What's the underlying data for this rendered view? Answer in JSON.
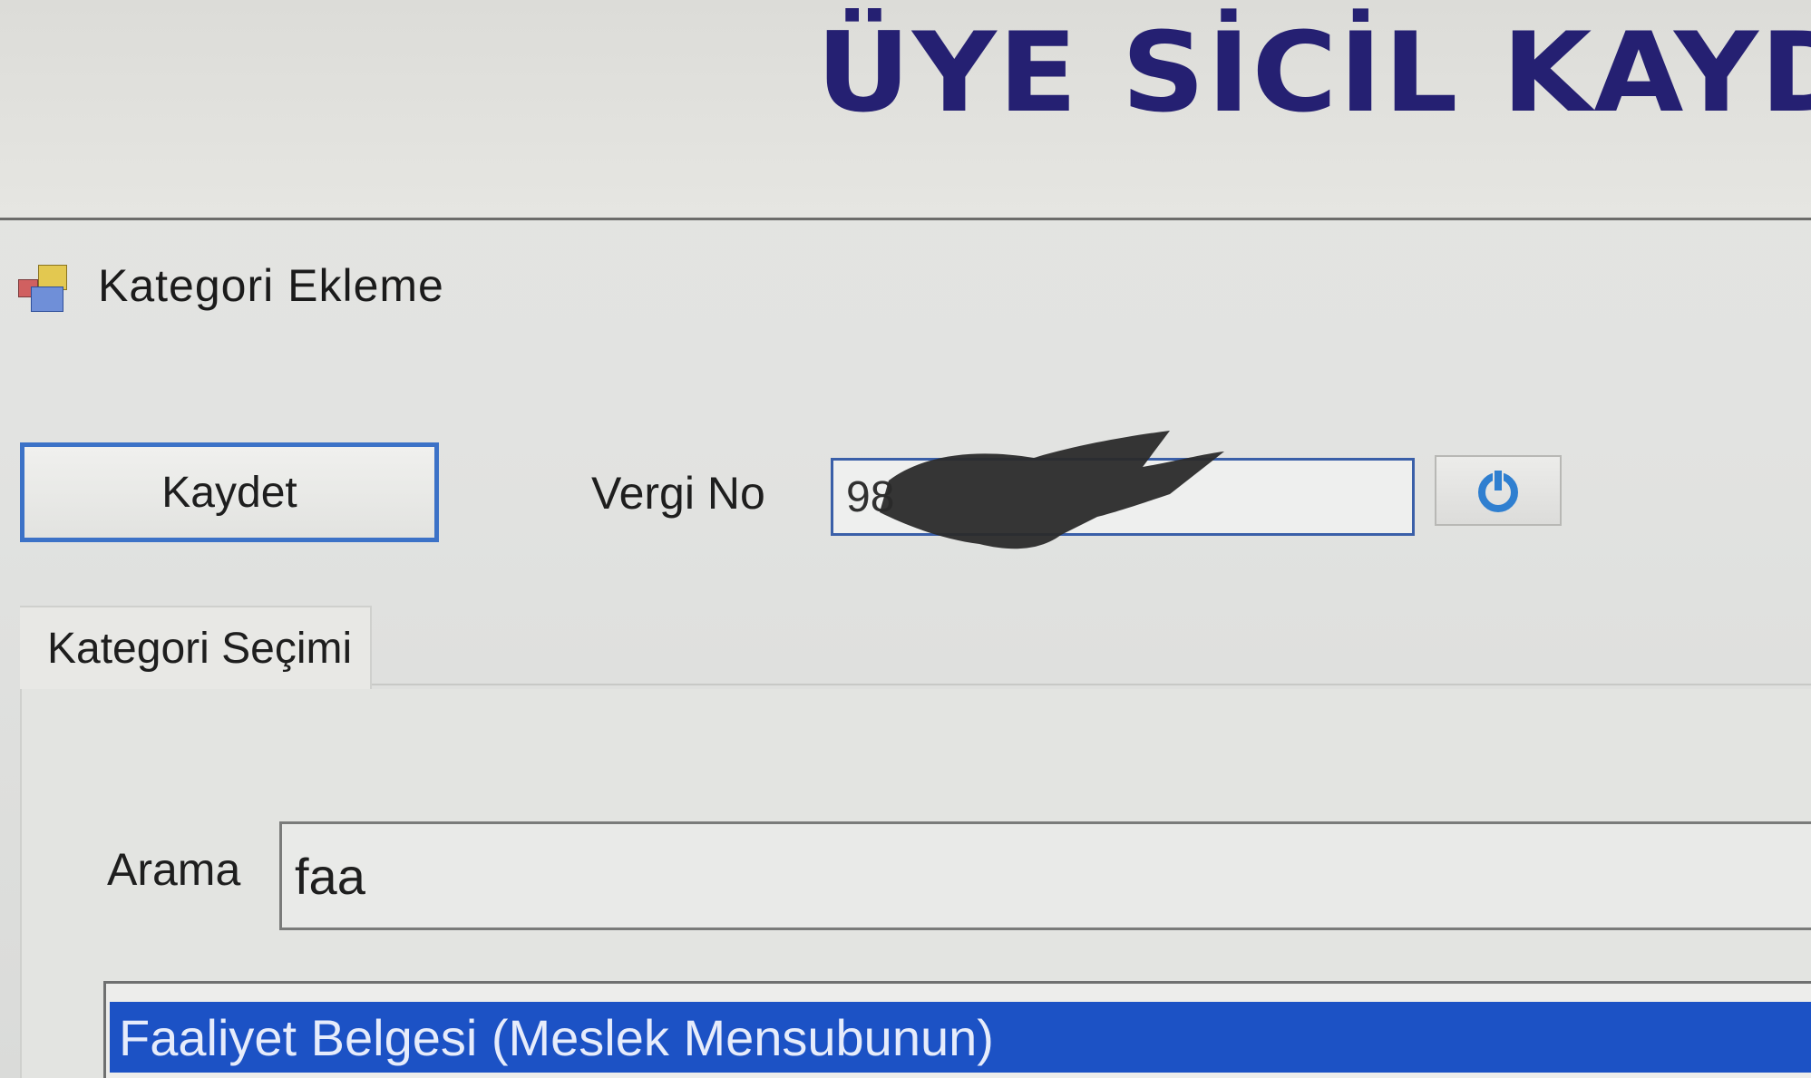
{
  "header": {
    "main_title": "ÜYE SİCİL KAYDI"
  },
  "window": {
    "title": "Kategori Ekleme",
    "icon": "app-window-icon"
  },
  "toolbar": {
    "save_label": "Kaydet",
    "tax_no_label": "Vergi No",
    "tax_no_value": "98",
    "tax_no_value_redacted": true,
    "refresh_icon": "refresh-icon",
    "accent_color": "#3c72c7"
  },
  "tabs": [
    {
      "label": "Kategori Seçimi",
      "active": true
    }
  ],
  "search": {
    "label": "Arama",
    "value": "faa"
  },
  "results": {
    "items": [
      {
        "label": "Faaliyet Belgesi (Meslek Mensubunun)",
        "selected": true
      }
    ],
    "selection_color": "#1c52c5"
  },
  "colors": {
    "title_color": "#252072"
  }
}
